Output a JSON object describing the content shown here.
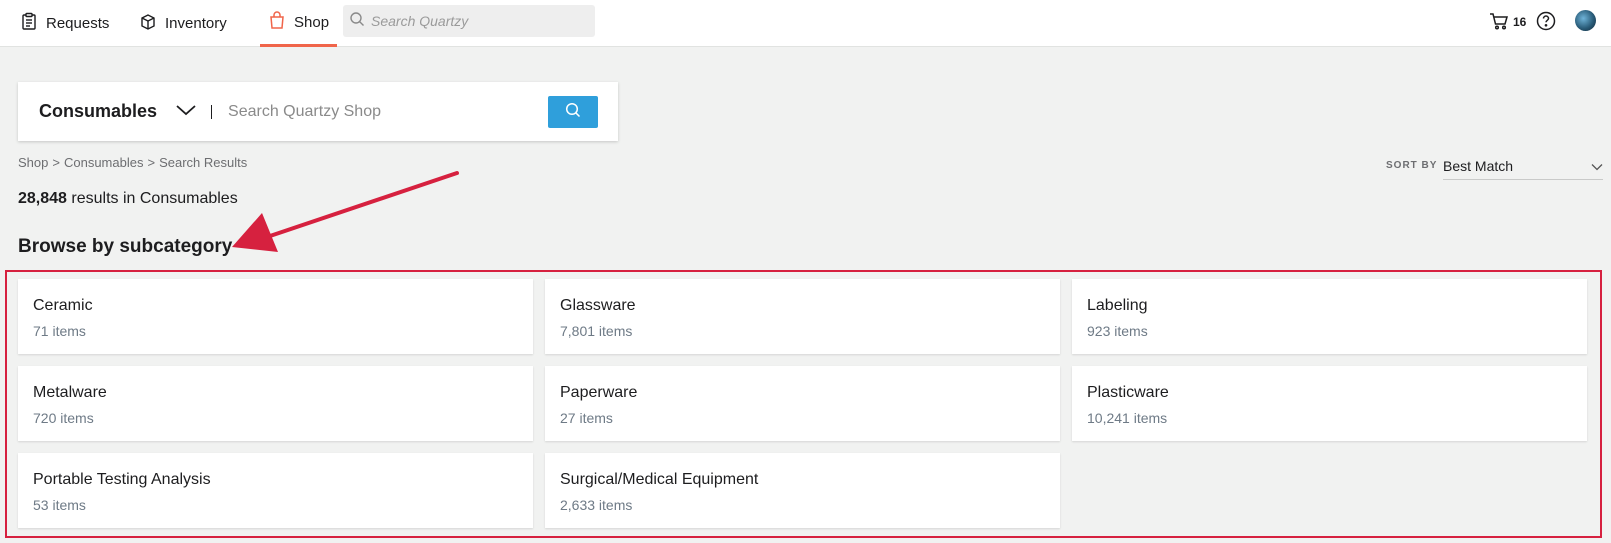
{
  "nav": {
    "requests": "Requests",
    "inventory": "Inventory",
    "shop": "Shop",
    "search_placeholder": "Search Quartzy",
    "cart_count": "16",
    "accent_color": "#f0654a"
  },
  "shop_search": {
    "category": "Consumables",
    "placeholder": "Search Quartzy Shop",
    "button_color": "#2f9fdb"
  },
  "breadcrumb": [
    "Shop",
    ">",
    "Consumables",
    ">",
    "Search Results"
  ],
  "results": {
    "count": "28,848",
    "text": "results in Consumables"
  },
  "sort": {
    "label": "SORT BY",
    "value": "Best Match"
  },
  "browse_heading": "Browse by subcategory",
  "subcategories": [
    {
      "name": "Ceramic",
      "count": "71 items"
    },
    {
      "name": "Glassware",
      "count": "7,801 items"
    },
    {
      "name": "Labeling",
      "count": "923 items"
    },
    {
      "name": "Metalware",
      "count": "720 items"
    },
    {
      "name": "Paperware",
      "count": "27 items"
    },
    {
      "name": "Plasticware",
      "count": "10,241 items"
    },
    {
      "name": "Portable Testing Analysis",
      "count": "53 items"
    },
    {
      "name": "Surgical/Medical Equipment",
      "count": "2,633 items"
    }
  ],
  "annotation_color": "#d6213f"
}
